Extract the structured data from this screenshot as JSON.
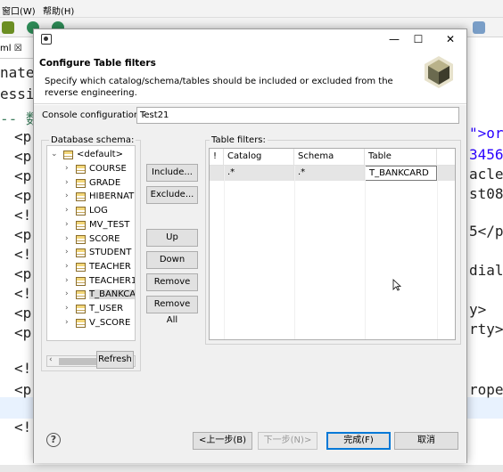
{
  "menubar": {
    "window": "窗口(W)",
    "help": "帮助(H)"
  },
  "editor_tab": "ml ☒",
  "editor_lines": {
    "l1": "nate",
    "l2": "essi",
    "l3": "-- 数",
    "l4": "<p",
    "l5": "<p",
    "l6": "<p",
    "l7": "<p",
    "l8": "<!",
    "l9": "<p",
    "l10": "<!",
    "l11": "<p",
    "l12": "<!",
    "l13": "<p",
    "l14": "<p",
    "l15": "<!",
    "l16": "<p",
    "l17": "<!",
    "r1": "\">ora",
    "r2": "3456<",
    "r3": "acles",
    "r4": "st08",
    "r5": "5</p",
    "r6": "diale",
    "r7": "y>",
    "r8": "rty>",
    "r9": "roper"
  },
  "dialog": {
    "title_icon": "dialog-app-icon",
    "minimize": "—",
    "maximize": "☐",
    "close": "✕",
    "banner_title": "Configure Table filters",
    "banner_desc": "Specify which catalog/schema/tables should be included or excluded from the reverse engineering.",
    "console_label": "Console configuration:",
    "console_value": "Test21",
    "schema_label": "Database schema:",
    "filters_label": "Table filters:",
    "tree": {
      "root": "<default>",
      "items": [
        "COURSE",
        "GRADE",
        "HIBERNATE",
        "LOG",
        "MV_TEST",
        "SCORE",
        "STUDENT",
        "TEACHER",
        "TEACHER1",
        "T_BANKCARD",
        "T_USER",
        "V_SCORE"
      ],
      "selected": "T_BANKCARD"
    },
    "buttons": {
      "include": "Include...",
      "exclude": "Exclude...",
      "up": "Up",
      "down": "Down",
      "remove": "Remove",
      "remove_all": "Remove All",
      "refresh": "Refresh",
      "back": "<上一步(B)",
      "next": "下一步(N)>",
      "finish": "完成(F)",
      "cancel": "取消"
    },
    "table": {
      "headers": {
        "flag": "!",
        "catalog": "Catalog",
        "schema": "Schema",
        "table": "Table"
      },
      "rows": [
        {
          "flag": "",
          "catalog": ".*",
          "schema": ".*",
          "table": "T_BANKCARD"
        }
      ]
    },
    "help": "?"
  }
}
